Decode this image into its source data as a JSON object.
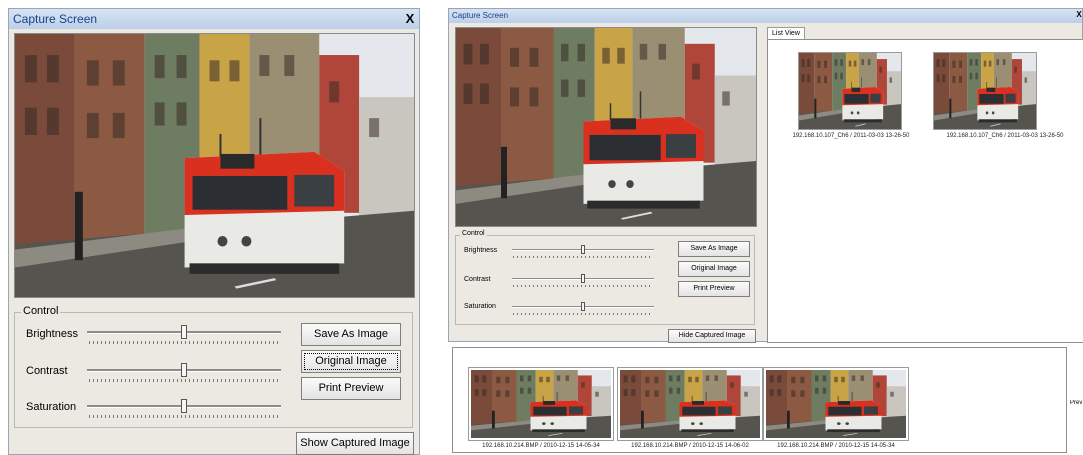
{
  "left": {
    "title": "Capture Screen",
    "close": "X",
    "control": {
      "legend": "Control",
      "brightness": "Brightness",
      "contrast": "Contrast",
      "saturation": "Saturation",
      "brightness_level": 0.5,
      "contrast_level": 0.5,
      "saturation_level": 0.5
    },
    "buttons": {
      "save": "Save As Image",
      "original": "Original Image",
      "print": "Print Preview",
      "show_captured": "Show Captured Image"
    }
  },
  "right": {
    "title": "Capture Screen",
    "close": "X",
    "control": {
      "legend": "Control",
      "brightness": "Brightness",
      "contrast": "Contrast",
      "saturation": "Saturation"
    },
    "buttons": {
      "save": "Save As Image",
      "original": "Original Image",
      "print": "Print Preview",
      "hide_captured": "Hide Captured Image"
    },
    "list_view": {
      "tab": "List View",
      "items": [
        {
          "caption": "192.168.10.107_Ch6 / 2011-03-03 13-26-50"
        },
        {
          "caption": "192.168.10.107_Ch6 / 2011-03-03 13-26-50"
        }
      ]
    },
    "captured": {
      "items": [
        {
          "caption": "192.168.10.214.BMP / 2010-12-15 14-05-34"
        },
        {
          "caption": "192.168.10.214.BMP / 2010-12-15 14-06-02"
        },
        {
          "caption": "192.168.10.214.BMP / 2010-12-15 14-05-34"
        }
      ],
      "side_label": "Prev"
    }
  },
  "colors": {
    "title_text": "#15428b",
    "window_bg": "#ece9e2",
    "tram_red": "#d9301f"
  },
  "icons": {
    "close": "close-icon"
  }
}
